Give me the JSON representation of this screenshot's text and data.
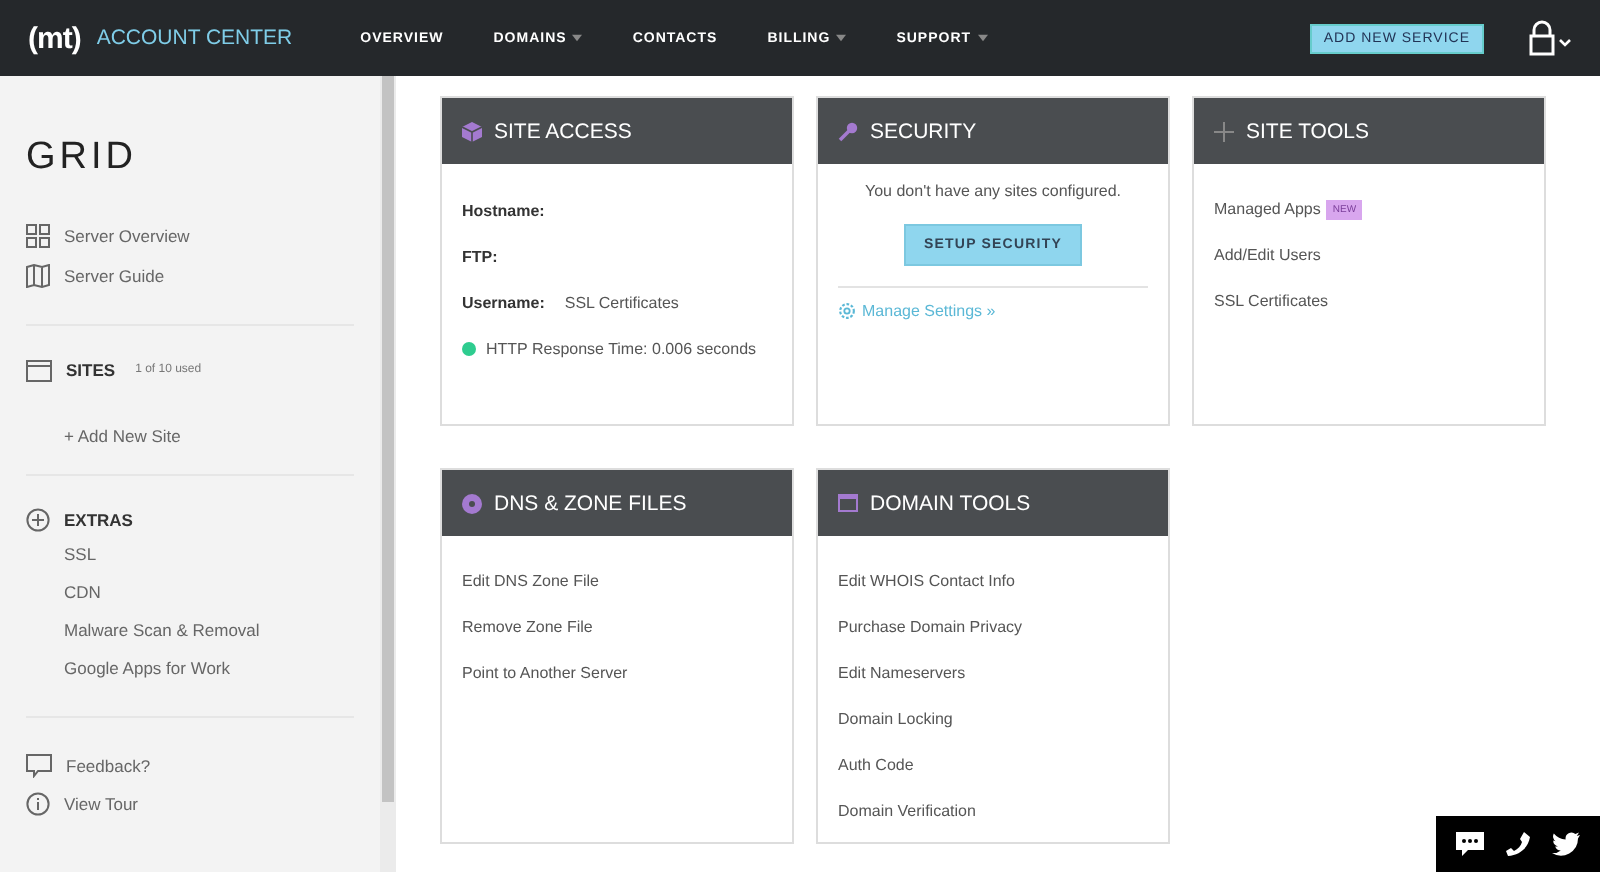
{
  "header": {
    "logo": "(mt)",
    "title": "ACCOUNT CENTER",
    "nav": [
      {
        "label": "OVERVIEW",
        "has_menu": false
      },
      {
        "label": "DOMAINS",
        "has_menu": true
      },
      {
        "label": "CONTACTS",
        "has_menu": false
      },
      {
        "label": "BILLING",
        "has_menu": true
      },
      {
        "label": "SUPPORT",
        "has_menu": true
      }
    ],
    "action_button": "ADD NEW SERVICE"
  },
  "sidebar": {
    "title": "GRID",
    "links": [
      {
        "label": "Server Overview"
      },
      {
        "label": "Server Guide"
      }
    ],
    "sites": {
      "label": "SITES",
      "count": "1 of 10 used",
      "add_link": "+ Add New Site"
    },
    "extras": {
      "label": "EXTRAS",
      "items": [
        "SSL",
        "CDN",
        "Malware Scan & Removal",
        "Google Apps for Work"
      ]
    },
    "footer": [
      {
        "label": "Feedback?"
      },
      {
        "label": "View Tour"
      }
    ]
  },
  "cards": [
    {
      "kind": "fields",
      "title": "SITE ACCESS",
      "fields": [
        {
          "label": "Hostname:"
        },
        {
          "label": "FTP:"
        },
        {
          "label": "Username:",
          "value": "SSL Certificates"
        }
      ],
      "status": {
        "text": "HTTP Response Time: 0.006 seconds"
      }
    },
    {
      "kind": "message",
      "title": "SECURITY",
      "message": "You don't have any sites configured.",
      "button": "SETUP SECURITY",
      "link": "Manage Settings »"
    },
    {
      "kind": "links",
      "title": "SITE TOOLS",
      "links": [
        {
          "label": "Managed Apps",
          "badge": "NEW"
        },
        {
          "label": "Add/Edit Users"
        },
        {
          "label": "SSL Certificates"
        }
      ]
    },
    {
      "kind": "links",
      "title": "DNS & ZONE FILES",
      "links": [
        {
          "label": "Edit DNS Zone File"
        },
        {
          "label": "Remove Zone File"
        },
        {
          "label": "Point to Another Server"
        }
      ]
    },
    {
      "kind": "links",
      "title": "DOMAIN TOOLS",
      "links": [
        {
          "label": "Edit WHOIS Contact Info"
        },
        {
          "label": "Purchase Domain Privacy"
        },
        {
          "label": "Edit Nameservers"
        },
        {
          "label": "Domain Locking"
        },
        {
          "label": "Auth Code"
        },
        {
          "label": "Domain Verification"
        }
      ]
    }
  ]
}
